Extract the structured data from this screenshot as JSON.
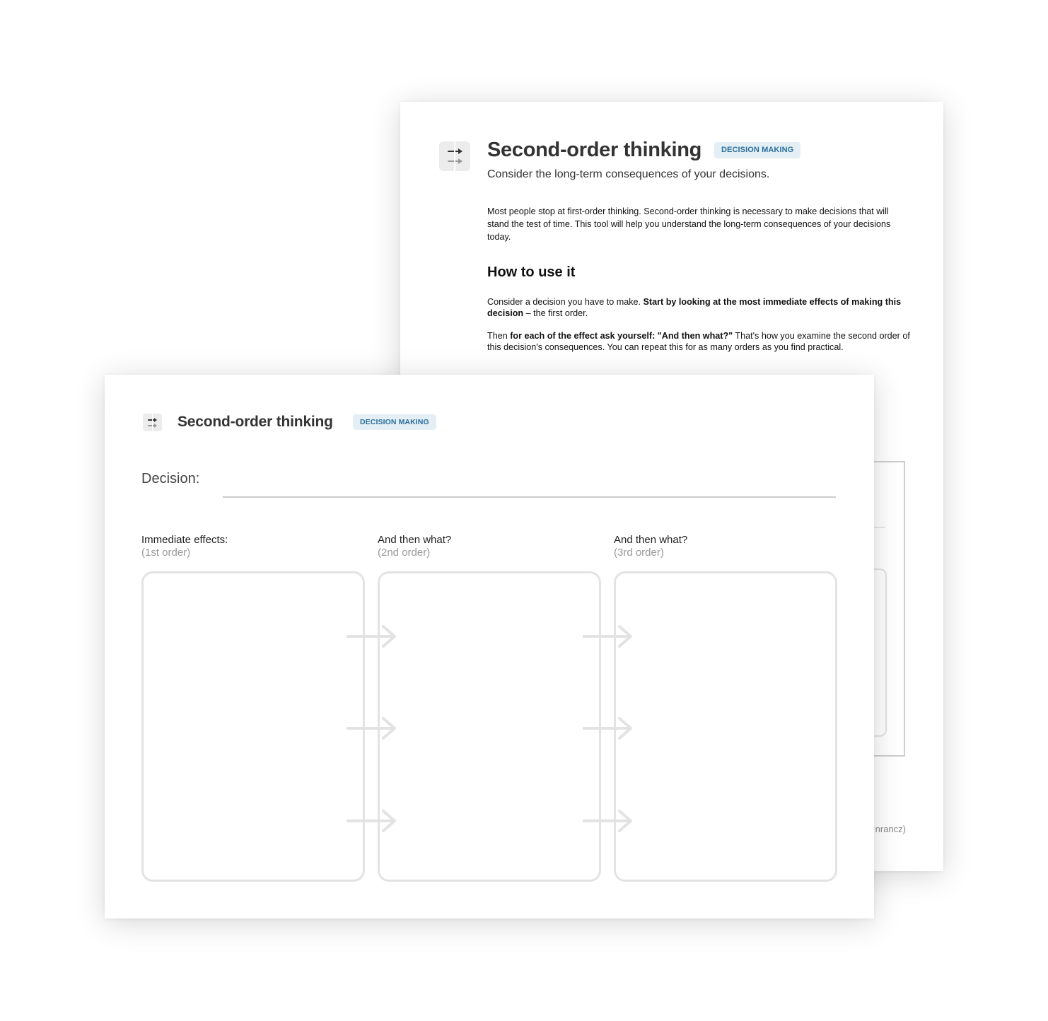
{
  "back_sheet": {
    "title": "Second-order thinking",
    "badge": "DECISION MAKING",
    "subtitle": "Consider the long-term consequences of your decisions.",
    "intro": "Most people stop at first-order thinking. Second-order thinking is necessary to make decisions that will stand the test of time. This tool will help you understand the long-term consequences of your decisions today.",
    "how_to_heading": "How to use it",
    "p1_start": "Consider a decision you have to make. ",
    "p1_bold": "Start by looking at the most immediate effects of making this decision",
    "p1_end": " – the first order.",
    "p2_start": "Then ",
    "p2_bold": "for each of the effect ask yourself: \"And then what?\"",
    "p2_end": " That's how you examine the second order of this decision's consequences. You can repeat this for as many orders as you find practical.",
    "credit_fragment": "nrancz)"
  },
  "front_sheet": {
    "title": "Second-order thinking",
    "badge": "DECISION MAKING",
    "decision_label": "Decision:",
    "columns": [
      {
        "heading": "Immediate effects:",
        "sub": "(1st order)"
      },
      {
        "heading": "And then what?",
        "sub": "(2nd order)"
      },
      {
        "heading": "And then what?",
        "sub": "(3rd order)"
      }
    ]
  },
  "colors": {
    "badge_bg": "#e4eef5",
    "badge_text": "#2a6f9c",
    "box_border": "#e3e3e3",
    "arrow": "#e3e3e3"
  },
  "icons": [
    "second-order-arrows-icon",
    "arrow-right-icon"
  ]
}
